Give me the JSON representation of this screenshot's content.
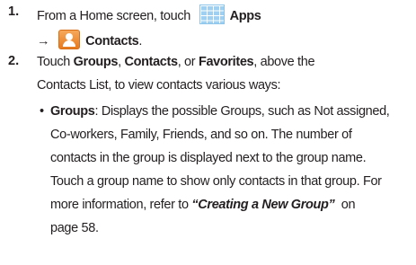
{
  "step1": {
    "number": "1.",
    "text_before": "From a Home screen, touch",
    "apps_label": "Apps",
    "arrow": "→",
    "contacts_label": "Contacts",
    "trailing": "."
  },
  "step2": {
    "number": "2.",
    "line1_touch": "Touch ",
    "groups_label": "Groups",
    "comma1": ", ",
    "contacts_label": "Contacts",
    "or": ", or ",
    "favorites_label": "Favorites",
    "line1_rest": ", above the",
    "line2": "Contacts List, to view contacts various ways:"
  },
  "bullet": {
    "marker": "•",
    "term": "Groups",
    "line1_rest": ": Displays the possible Groups, such as Not assigned,",
    "line2": "Co-workers, Family, Friends, and so on. The number of",
    "line3": "contacts in the group is displayed next to the group name.",
    "line4": "Touch a group name to show only contacts in that group. For",
    "line5_before": "more information, refer to ",
    "line5_link": "“Creating a New Group”",
    "line5_after": "  on",
    "line6": "page 58."
  },
  "icons": {
    "apps": "apps-grid-icon",
    "contacts": "contacts-person-icon"
  }
}
